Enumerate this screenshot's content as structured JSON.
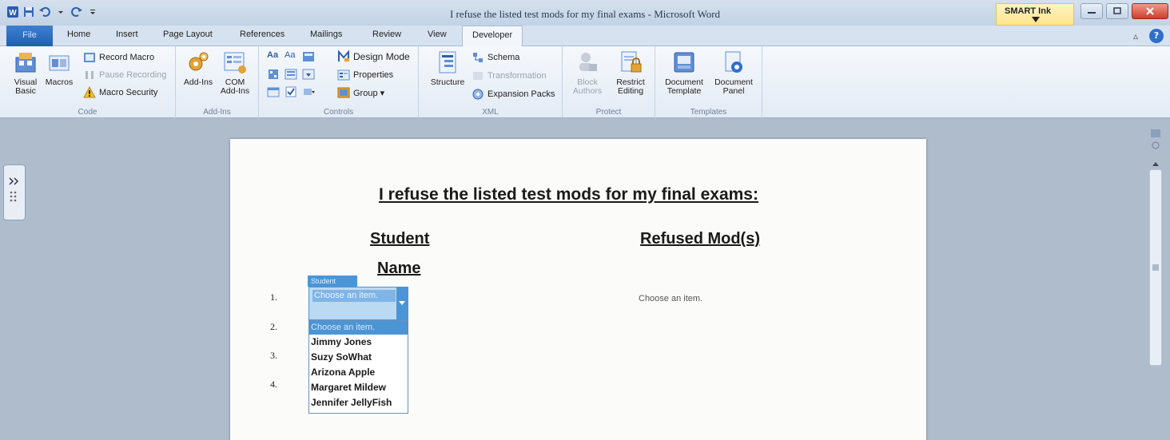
{
  "window": {
    "title": "I refuse the listed test mods for my final exams - Microsoft Word",
    "smart_ink": "SMART Ink"
  },
  "tabs": [
    {
      "label": "File"
    },
    {
      "label": "Home"
    },
    {
      "label": "Insert"
    },
    {
      "label": "Page Layout"
    },
    {
      "label": "References"
    },
    {
      "label": "Mailings"
    },
    {
      "label": "Review"
    },
    {
      "label": "View"
    },
    {
      "label": "Developer"
    }
  ],
  "ribbon": {
    "code": {
      "label": "Code",
      "visual_basic": "Visual Basic",
      "macros": "Macros",
      "record_macro": "Record Macro",
      "pause_recording": "Pause Recording",
      "macro_security": "Macro Security"
    },
    "addins": {
      "label": "Add-Ins",
      "add_ins": "Add-Ins",
      "com_add_ins": "COM Add-Ins"
    },
    "controls": {
      "label": "Controls",
      "aa1": "Aa",
      "aa2": "Aa",
      "design_mode": "Design Mode",
      "properties": "Properties",
      "group": "Group ▾"
    },
    "xml": {
      "label": "XML",
      "structure": "Structure",
      "schema": "Schema",
      "transformation": "Transformation",
      "expansion_packs": "Expansion Packs"
    },
    "protect": {
      "label": "Protect",
      "block_authors": "Block Authors",
      "restrict_editing": "Restrict Editing"
    },
    "templates": {
      "label": "Templates",
      "document_template": "Document Template",
      "document_panel": "Document Panel"
    }
  },
  "document": {
    "title": "I refuse the listed test mods for my final exams:",
    "col_student_line1": "Student",
    "col_student_line2": "Name",
    "col_mods": "Refused Mod(s)",
    "numbers": [
      "1.",
      "2.",
      "3.",
      "4."
    ],
    "refused_placeholder": "Choose an item.",
    "content_control": {
      "tag": "Student",
      "value": "Choose an item."
    },
    "dropdown_options": [
      "Choose an item.",
      "Jimmy Jones",
      "Suzy SoWhat",
      "Arizona Apple",
      "Margaret Mildew",
      "Jennifer JellyFish"
    ]
  },
  "colors": {
    "accent": "#4b95d6",
    "file_tab": "#2a6cc4",
    "close_button": "#c9402b"
  }
}
